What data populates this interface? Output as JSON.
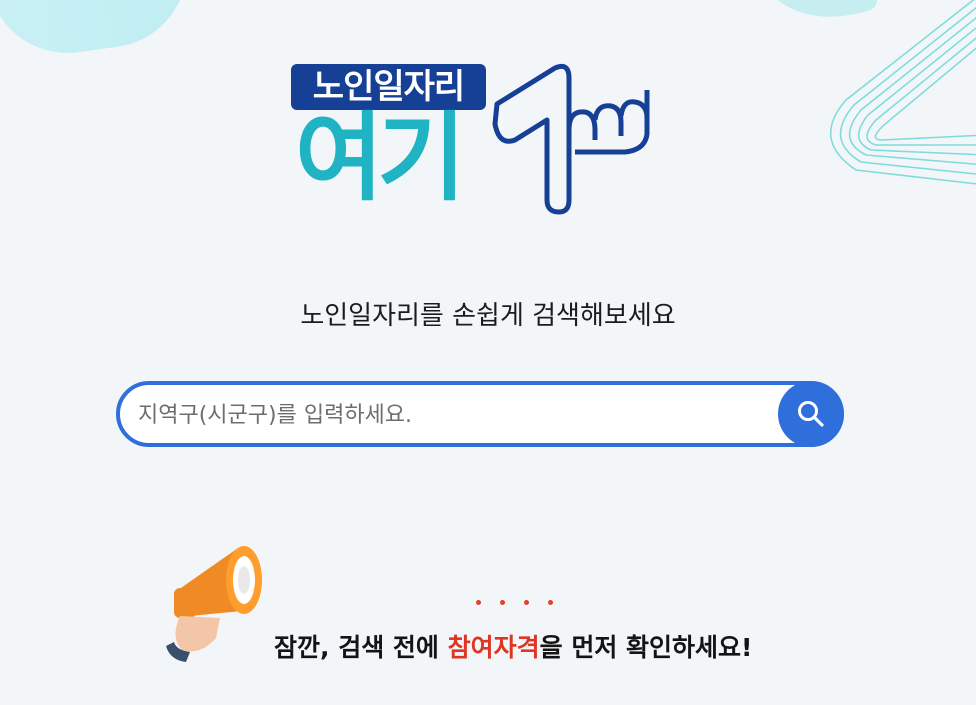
{
  "logo": {
    "badge_text": "노인일자리",
    "big_text": "여기"
  },
  "subtitle": "노인일자리를 손쉽게 검색해보세요",
  "search": {
    "placeholder": "지역구(시군구)를 입력하세요.",
    "value": ""
  },
  "notice": {
    "dots": "....",
    "prefix": "잠깐, 검색 전에 ",
    "highlight": "참여자격",
    "suffix": "을 먼저 확인하세요!"
  },
  "colors": {
    "accent": "#2f6fdc",
    "brand_navy": "#163f96",
    "brand_teal": "#1fb3c3",
    "highlight": "#df3523"
  },
  "icons": {
    "search": "search-icon",
    "megaphone": "megaphone-icon"
  }
}
